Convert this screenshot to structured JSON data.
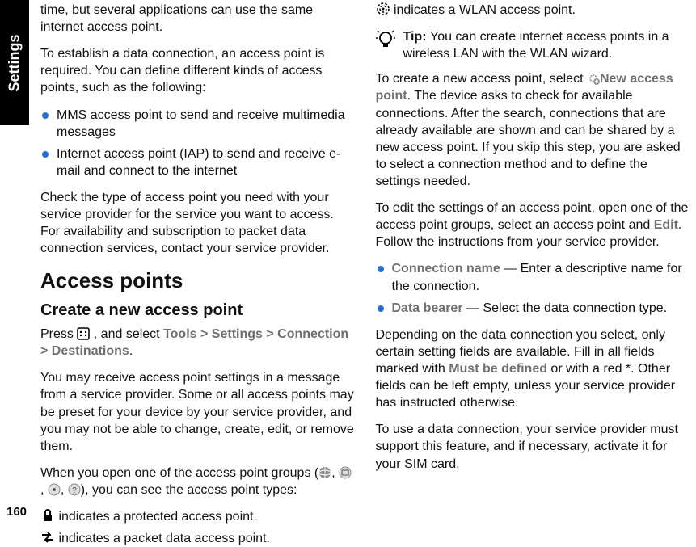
{
  "sideTab": "Settings",
  "pageNumber": "160",
  "leftCol": {
    "p1": "time, but several applications can use the same internet access point.",
    "p2": "To establish a data connection, an access point is required. You can define different kinds of access points, such as the following:",
    "bullets1": [
      "MMS access point to send and receive multimedia messages",
      "Internet access point (IAP) to send and receive e-mail and connect to the internet"
    ],
    "p3": "Check the type of access point you need with your service provider for the service you want to access. For availability and subscription to packet data connection services, contact your service provider.",
    "h2": "Access points",
    "h3": "Create a new access point",
    "pressPrefix": "Press ",
    "pressSuffix1": " , and select ",
    "nav1": "Tools",
    "nav2": "Settings",
    "nav3": "Connection",
    "nav4": "Destinations",
    "p5": "You may receive access point settings in a message from a service provider. Some or all access points may be preset for your device by your service provider, and you may not be able to change, create, edit, or remove them.",
    "p6a": "When you open one of the access point groups (",
    "p6b": "), you can see the access point types:",
    "legend1": " indicates a protected access point.",
    "legend2": " indicates a packet data access point."
  },
  "rightCol": {
    "legend3": " indicates a WLAN access point.",
    "tipLabel": "Tip: ",
    "tipText": "You can create internet access points in a wireless LAN with the WLAN wizard.",
    "p1a": "To create a new access point, select ",
    "p1link": "New access point",
    "p1b": ". The device asks to check for available connections. After the search, connections that are already available are shown and can be shared by a new access point. If you skip this step, you are asked to select a connection method and to define the settings needed.",
    "p2a": "To edit the settings of an access point, open one of the access point groups, select an access point and ",
    "editLabel": "Edit",
    "p2b": ". Follow the instructions from your service provider.",
    "bullets2": [
      {
        "label": "Connection name",
        "dash": " — ",
        "text": "Enter a descriptive name for the connection."
      },
      {
        "label": "Data bearer",
        "dash": " — ",
        "text": "Select the data connection type."
      }
    ],
    "p3a": "Depending on the data connection you select, only certain setting fields are available. Fill in all fields marked with ",
    "mustDef": "Must be defined",
    "p3b": " or with a red *. Other fields can be left empty, unless your service provider has instructed otherwise.",
    "p4": "To use a data connection, your service provider must support this feature, and if necessary, activate it for your SIM card."
  }
}
